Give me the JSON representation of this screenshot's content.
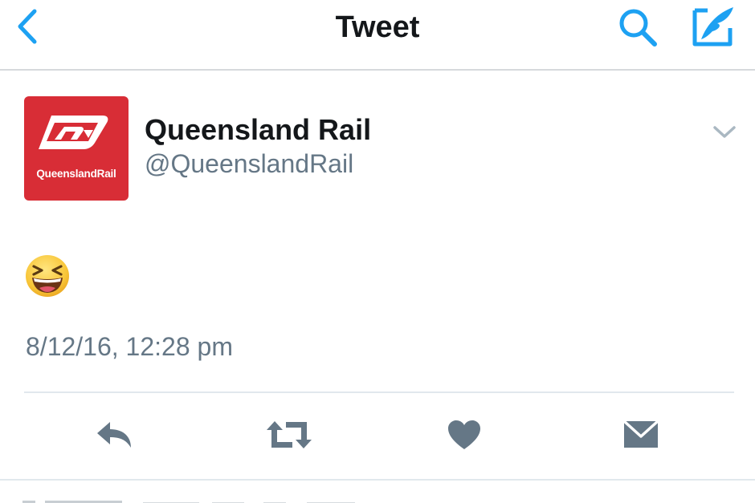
{
  "nav": {
    "title": "Tweet",
    "back_icon": "chevron-left-icon",
    "search_icon": "search-icon",
    "compose_icon": "compose-quill-icon"
  },
  "tweet": {
    "author": {
      "display_name": "Queensland Rail",
      "handle": "@QueenslandRail",
      "avatar_logo_text": "QueenslandRail"
    },
    "body_emoji": "grinning-squinting-face",
    "timestamp": "8/12/16, 12:28 pm"
  },
  "actions": {
    "reply_icon": "reply-icon",
    "retweet_icon": "retweet-icon",
    "like_icon": "heart-icon",
    "dm_icon": "envelope-icon"
  },
  "colors": {
    "accent": "#1da1f2",
    "brand_red": "#d82d36",
    "text_primary": "#14171a",
    "text_secondary": "#657786",
    "icon_gray": "#657786",
    "divider": "#e1e8ed"
  }
}
